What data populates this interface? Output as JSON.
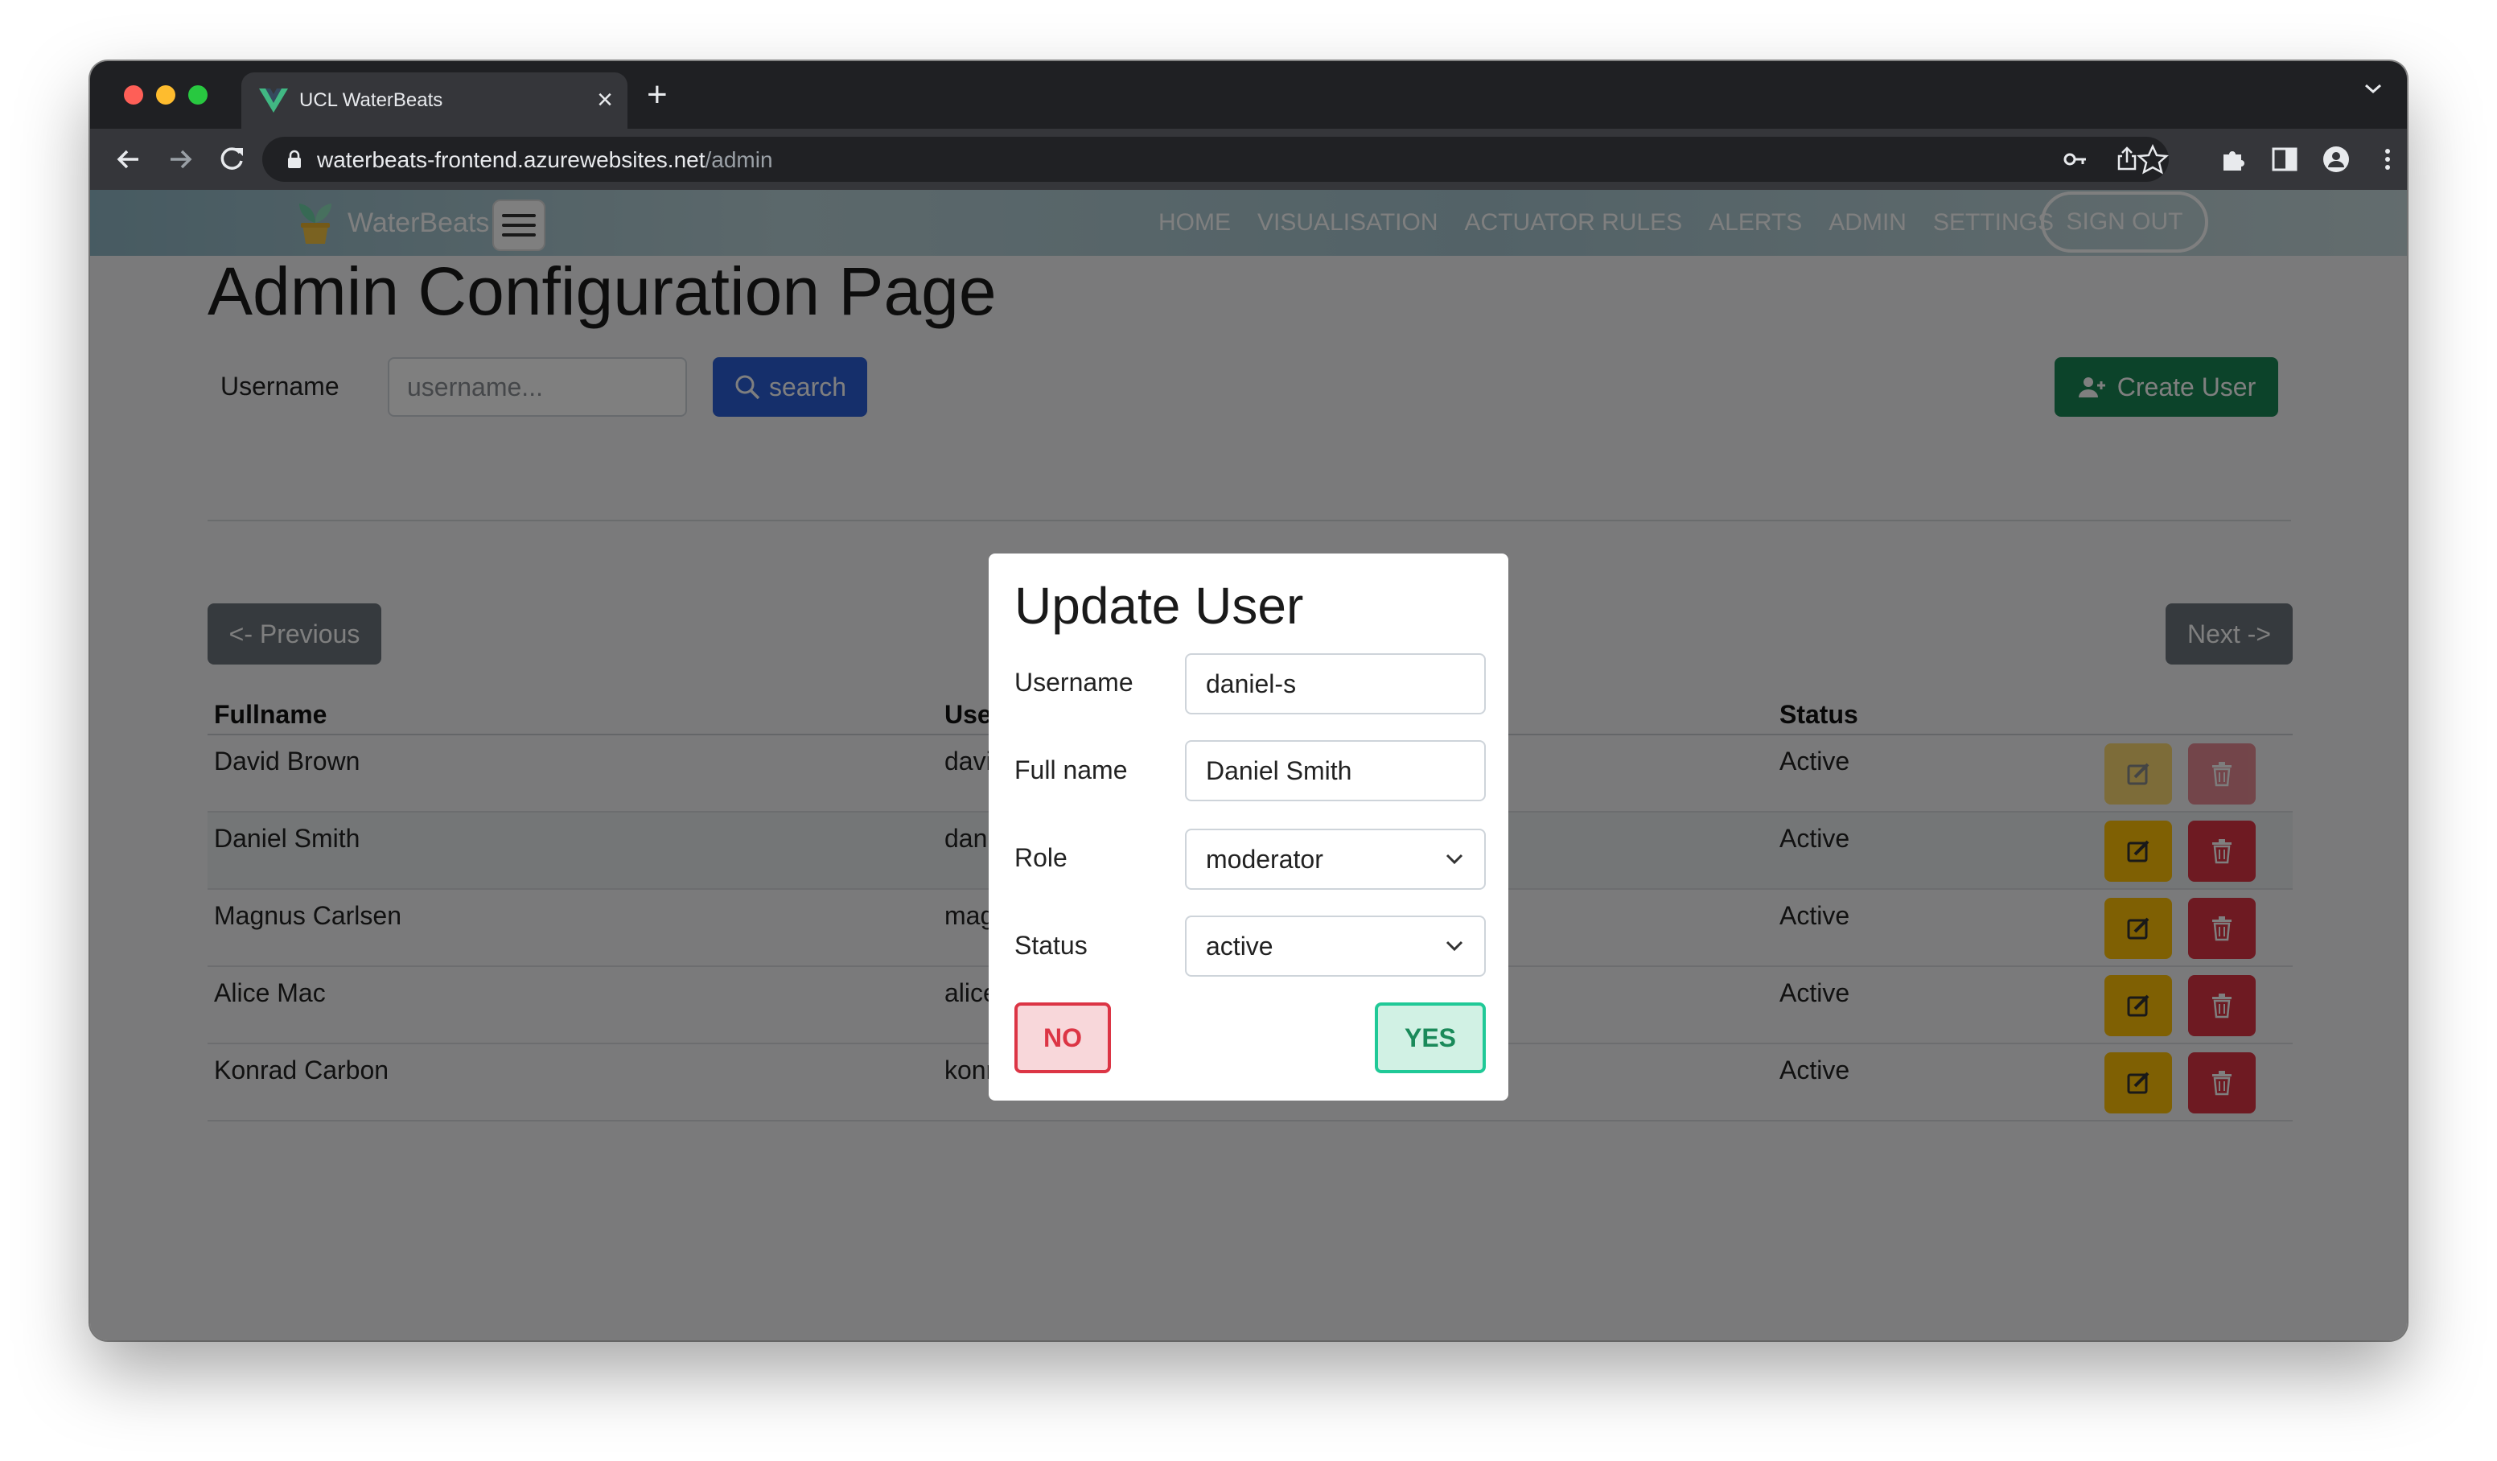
{
  "browser": {
    "tab_title": "UCL WaterBeats",
    "url_domain": "waterbeats-frontend.azurewebsites.net",
    "url_path": "/admin",
    "tab_close_glyph": "×",
    "new_tab_glyph": "+"
  },
  "navbar": {
    "brand": "WaterBeats",
    "links": [
      "HOME",
      "VISUALISATION",
      "ACTUATOR RULES",
      "ALERTS",
      "ADMIN",
      "SETTINGS"
    ],
    "sign_out": "SIGN OUT"
  },
  "page": {
    "title": "Admin Configuration Page",
    "search": {
      "label": "Username",
      "placeholder": "username...",
      "button": "search"
    },
    "create_user": "Create User",
    "pagination": {
      "previous": "<- Previous",
      "next": "Next ->"
    }
  },
  "table": {
    "headers": {
      "fullname": "Fullname",
      "username": "Use",
      "status": "Status"
    },
    "rows": [
      {
        "fullname": "David Brown",
        "username": "davi",
        "status": "Active"
      },
      {
        "fullname": "Daniel Smith",
        "username": "dani",
        "status": "Active"
      },
      {
        "fullname": "Magnus Carlsen",
        "username": "mag",
        "status": "Active"
      },
      {
        "fullname": "Alice Mac",
        "username": "alice",
        "status": "Active"
      },
      {
        "fullname": "Konrad Carbon",
        "username": "konr",
        "status": "Active"
      }
    ]
  },
  "modal": {
    "title": "Update User",
    "fields": {
      "username_label": "Username",
      "username_value": "daniel-s",
      "fullname_label": "Full name",
      "fullname_value": "Daniel Smith",
      "role_label": "Role",
      "role_value": "moderator",
      "status_label": "Status",
      "status_value": "active"
    },
    "no_button": "NO",
    "yes_button": "YES"
  },
  "colors": {
    "primary": "#2a5fd6",
    "success": "#198754",
    "warning": "#ffc107",
    "danger": "#dc3545",
    "secondary": "#6c757d"
  },
  "icons": [
    "lock-icon",
    "search-icon",
    "add-user-icon",
    "edit-icon",
    "trash-icon",
    "chevron-down-icon",
    "plant-logo-icon",
    "vue-favicon-icon",
    "hamburger-icon"
  ]
}
